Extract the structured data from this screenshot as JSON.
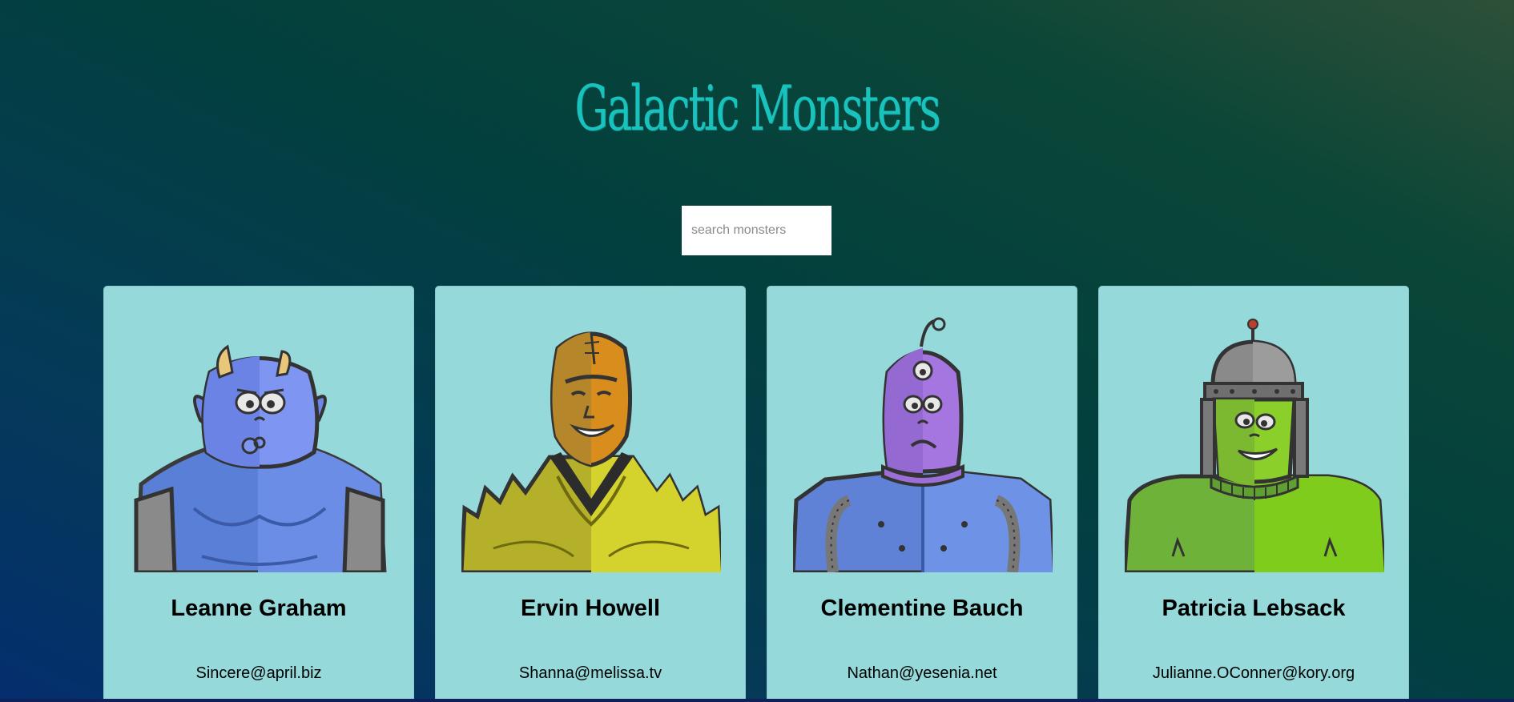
{
  "app": {
    "title": "Galactic Monsters"
  },
  "search": {
    "placeholder": "search monsters",
    "value": ""
  },
  "monsters": [
    {
      "name": "Leanne Graham",
      "email": "Sincere@april.biz"
    },
    {
      "name": "Ervin Howell",
      "email": "Shanna@melissa.tv"
    },
    {
      "name": "Clementine Bauch",
      "email": "Nathan@yesenia.net"
    },
    {
      "name": "Patricia Lebsack",
      "email": "Julianne.OConner@kory.org"
    }
  ],
  "colors": {
    "title": "#19c2bd",
    "card_background": "#95d9da",
    "search_background": "#ffffff"
  }
}
